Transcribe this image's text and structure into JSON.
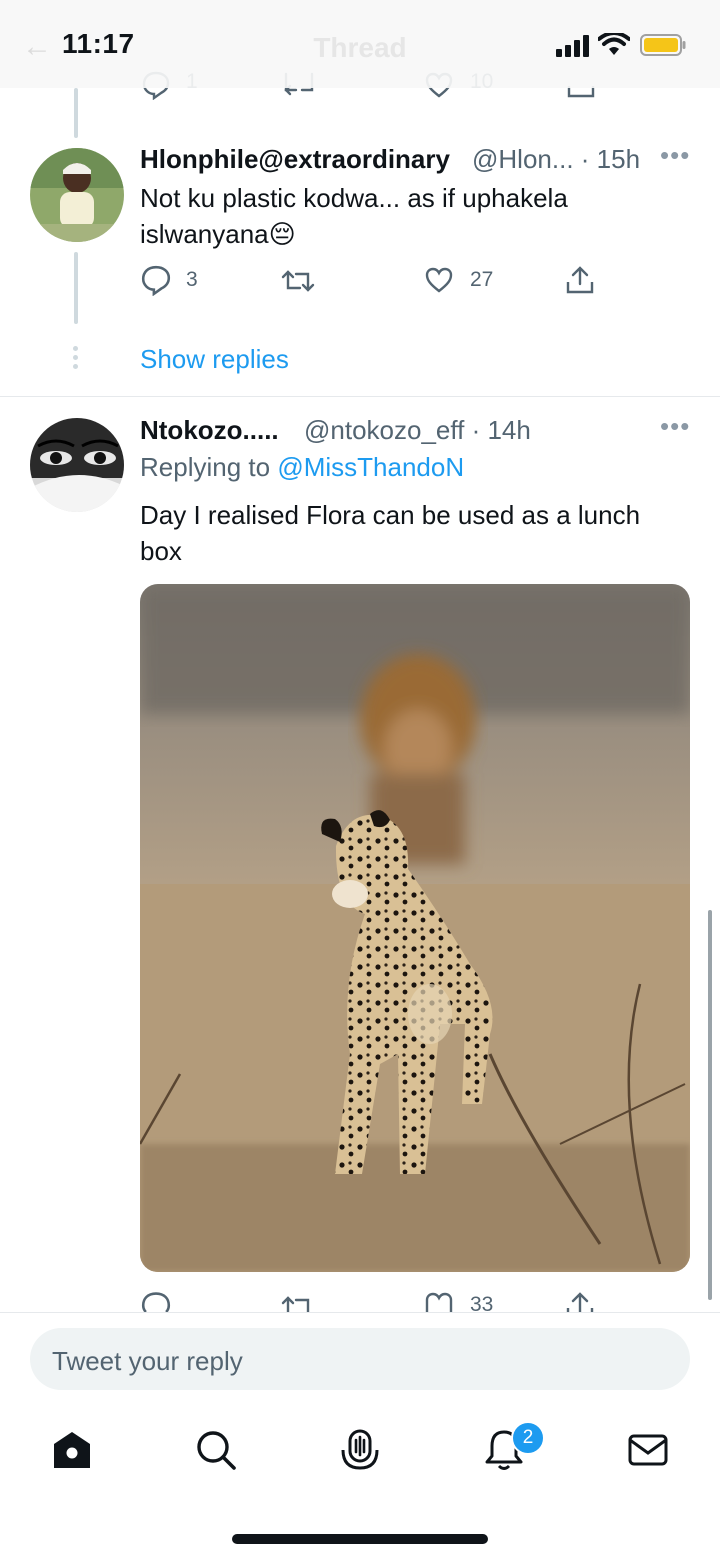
{
  "status_bar": {
    "time": "11:17"
  },
  "header": {
    "title": "Thread"
  },
  "prev_actions": {
    "replies": "1",
    "likes": "10"
  },
  "tweet1": {
    "name": "Hlonphile@extraordinary",
    "handle_time": "@Hlon... · 15h",
    "text": "Not ku plastic kodwa... as if uphakela islwanyana😔",
    "replies": "3",
    "retweets": "",
    "likes": "27"
  },
  "show_replies": "Show replies",
  "tweet2": {
    "name": "Ntokozo.....",
    "handle_time": "@ntokozo_eff · 14h",
    "replying_prefix": "Replying to ",
    "replying_to": "@MissThandoN",
    "text": "Day I realised Flora can be used as a lunch box",
    "likes": "33"
  },
  "reply_input": {
    "placeholder": "Tweet your reply"
  },
  "tab_bar": {
    "items": [
      "home-icon",
      "search-icon",
      "spaces-icon",
      "notifications-icon",
      "messages-icon"
    ],
    "notification_badge": "2"
  },
  "colors": {
    "accent": "#1d9bf0",
    "muted": "#536471",
    "thread_line": "#cfd9de"
  }
}
